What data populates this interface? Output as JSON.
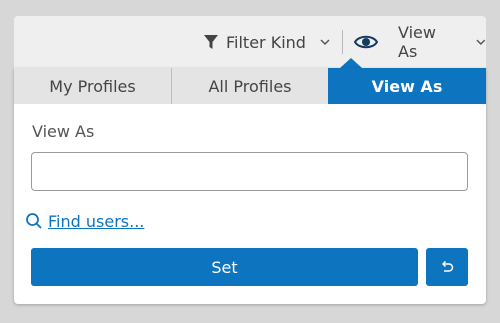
{
  "toolbar": {
    "filter_label": "Filter Kind",
    "filter_icon": "filter-icon",
    "view_as_label": "View As",
    "view_as_icon": "eye-icon"
  },
  "tabs": [
    {
      "label": "My Profiles",
      "active": false
    },
    {
      "label": "All Profiles",
      "active": false
    },
    {
      "label": "View As",
      "active": true
    }
  ],
  "form": {
    "field_label": "View As",
    "input_value": "",
    "input_placeholder": "",
    "find_users_label": " Find users...",
    "find_users_icon": "search-icon",
    "set_label": "Set",
    "reset_icon": "undo-icon"
  },
  "colors": {
    "accent": "#0d74bf",
    "background": "#d7d7d7",
    "toolbar_bg": "#efefef",
    "tab_inactive_bg": "#e4e4e4"
  }
}
